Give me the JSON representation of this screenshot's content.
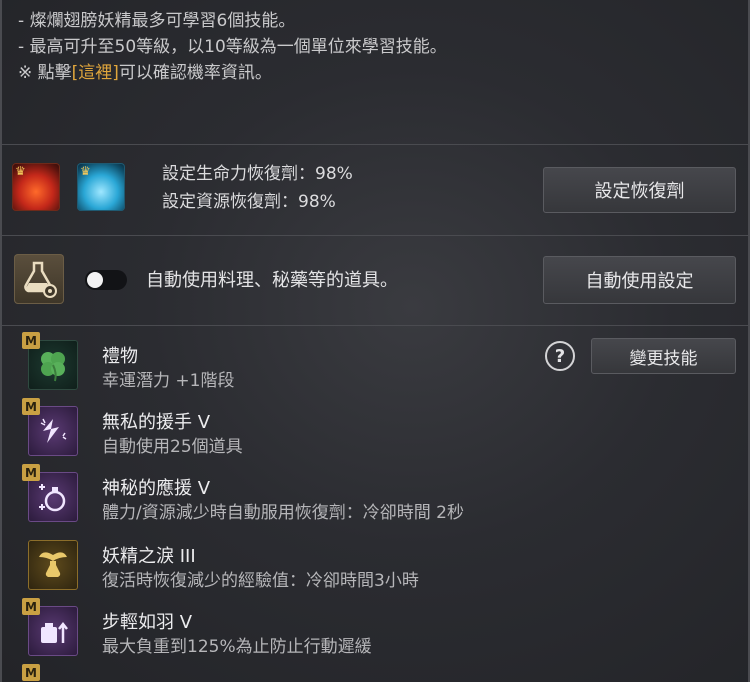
{
  "notes": [
    "- 燦爛翅膀妖精最多可學習6個技能。",
    "- 最高可升至50等級，以10等級為一個單位來學習技能。"
  ],
  "note_link": {
    "prefix": "※ 點擊",
    "link": "[這裡]",
    "suffix": "可以確認機率資訊。"
  },
  "recovery": {
    "hp_text": "設定生命力恢復劑：98%",
    "resource_text": "設定資源恢復劑：98%",
    "button": "設定恢復劑"
  },
  "auto_use": {
    "text": "自動使用料理、秘藥等的道具。",
    "button": "自動使用設定",
    "toggle_on": false
  },
  "skills_header": {
    "help": "?",
    "change_button": "變更技能"
  },
  "skills": [
    {
      "badge": "M",
      "name": "禮物",
      "desc": "幸運潛力 +1階段",
      "icon": "clover-icon"
    },
    {
      "badge": "M",
      "name": "無私的援手 V",
      "desc": "自動使用25個道具",
      "icon": "fairy-icon"
    },
    {
      "badge": "M",
      "name": "神秘的應援 V",
      "desc": "體力/資源減少時自動服用恢復劑：冷卻時間 2秒",
      "icon": "potions-icon"
    },
    {
      "badge": "",
      "name": "妖精之淚 III",
      "desc": "復活時恢復減少的經驗值：冷卻時間3小時",
      "icon": "winged-vial-icon"
    },
    {
      "badge": "M",
      "name": "步輕如羽 V",
      "desc": "最大負重到125%為止防止行動遲緩",
      "icon": "weight-icon"
    }
  ],
  "colors": {
    "highlight": "#e0a63c",
    "badge": "#c9a043"
  }
}
